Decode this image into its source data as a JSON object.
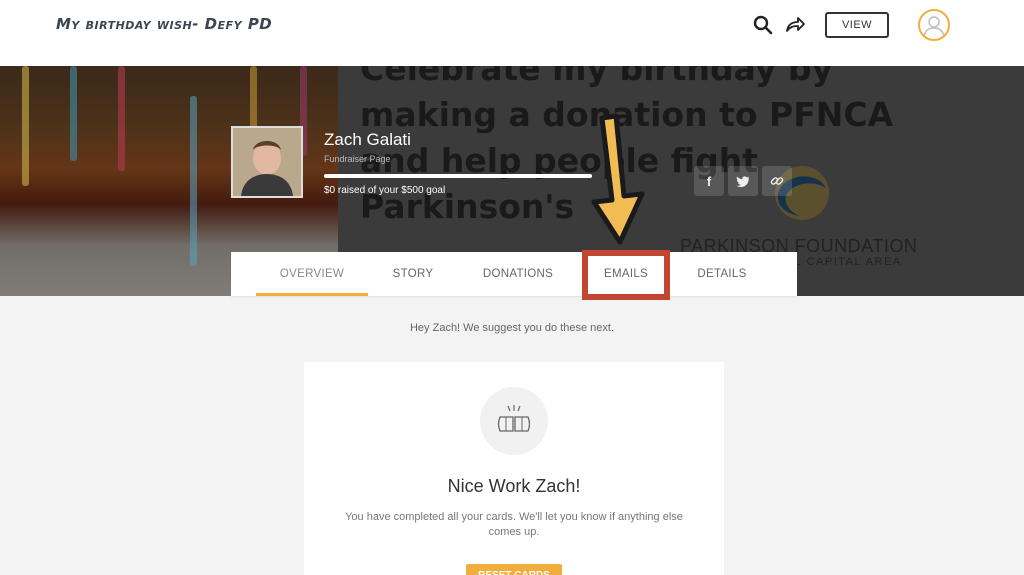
{
  "header": {
    "title": "My birthday wish- Defy PD",
    "view_label": "VIEW",
    "icons": [
      "search-icon",
      "share-arrow-icon",
      "user-avatar-icon"
    ]
  },
  "hero": {
    "headline": "Celebrate my birthday by making a donation to PFNCA and help people fight Parkinson's",
    "org_name": "PARKINSON FOUNDATION",
    "org_sub": "AL CAPITAL AREA"
  },
  "fundraiser": {
    "name": "Zach Galati",
    "type": "Fundraiser Page",
    "raised_text": "$0 raised of your $500 goal",
    "progress_fraction": 0.0
  },
  "social": {
    "facebook": "f",
    "twitter": "twitter-icon",
    "link": "link-icon"
  },
  "tabs": [
    {
      "label": "OVERVIEW",
      "active": true
    },
    {
      "label": "STORY",
      "active": false
    },
    {
      "label": "DONATIONS",
      "active": false
    },
    {
      "label": "EMAILS",
      "active": false
    },
    {
      "label": "DETAILS",
      "active": false
    }
  ],
  "main": {
    "suggest_text": "Hey Zach! We suggest you do these next.",
    "card": {
      "title": "Nice Work Zach!",
      "text": "You have completed all your cards. We'll let you know if anything else comes up.",
      "button_label": "RESET CARDS"
    }
  },
  "colors": {
    "accent": "#f2ae3c",
    "highlight": "#c2462f"
  }
}
